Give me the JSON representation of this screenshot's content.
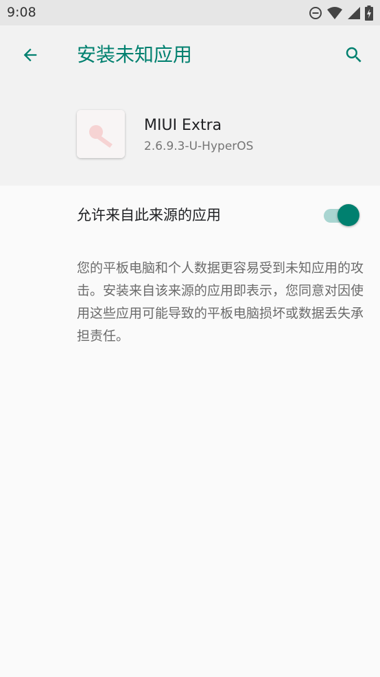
{
  "status_bar": {
    "time": "9:08",
    "icons": [
      "dnd-icon",
      "wifi-icon",
      "signal-icon",
      "battery-charging-icon"
    ]
  },
  "toolbar": {
    "title": "安装未知应用",
    "back_icon": "arrow-back-icon",
    "search_icon": "search-icon"
  },
  "app": {
    "name": "MIUI Extra",
    "version": "2.6.9.3-U-HyperOS"
  },
  "setting": {
    "label": "允许来自此来源的应用",
    "enabled": true
  },
  "warning": {
    "text": "您的平板电脑和个人数据更容易受到未知应用的攻击。安装来自该来源的应用即表示，您同意对因使用这些应用可能导致的平板电脑损坏或数据丢失承担责任。"
  },
  "colors": {
    "accent": "#00806f",
    "header_background": "#f2f2f2",
    "page_background": "#fafafa",
    "status_bar_background": "#e6e6e6",
    "toggle_track": "#a9d5d1"
  }
}
